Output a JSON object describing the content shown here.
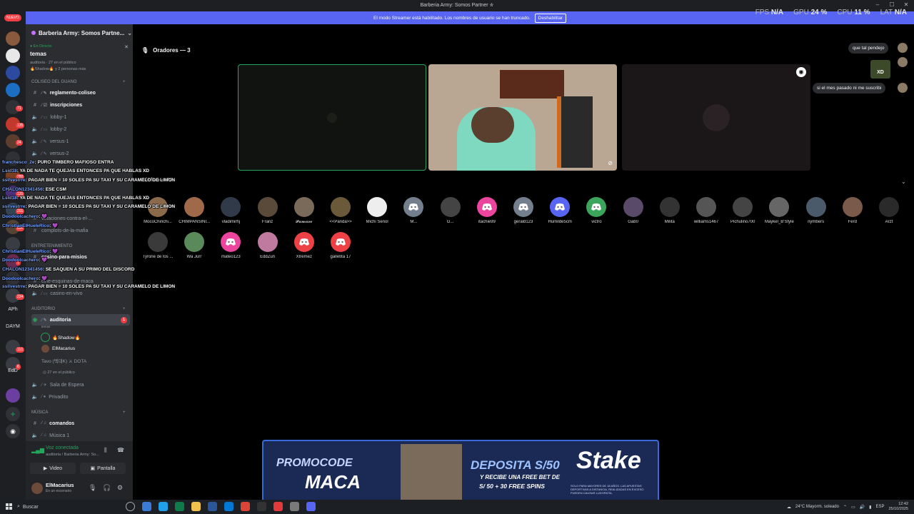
{
  "window": {
    "title": "Barberia Army: Somos Partner ✮"
  },
  "perf": [
    {
      "label": "FPS",
      "value": "N/A"
    },
    {
      "label": "GPU",
      "value": "24 %"
    },
    {
      "label": "CPU",
      "value": "11 %"
    },
    {
      "label": "LAT",
      "value": "N/A"
    }
  ],
  "banner": {
    "text": "El modo Streamer está habilitado. Los nombres de usuario se han truncado.",
    "button": "Deshabilitar"
  },
  "rail": {
    "new_badge": "NUEVO",
    "labels": [
      "APh",
      "DAYM",
      "EdD"
    ],
    "pills": [
      "71",
      "135",
      "24",
      "280",
      "131",
      "201",
      "99+",
      "1",
      "224",
      "110",
      "6"
    ]
  },
  "sidebar": {
    "server_name": "Barberia Army: Somos Partne...",
    "live": {
      "status": "En Directo",
      "name": "temas",
      "meta": "auditoria · 27 en el público",
      "meta2": "🔥Shadow🔥 y 2 personas más"
    },
    "categories": {
      "coliseo": "COLISEO DEL GUANO",
      "entretenimiento": "ENTRETENIMIENTO",
      "auditorio": "AUDITORIO",
      "musica": "MÚSICA"
    },
    "channels": {
      "reglamento": "reglamento-coliseo",
      "inscripciones": "inscripciones",
      "lobby1": "lobby-1",
      "lobby2": "lobby-2",
      "versus1": "versus-1",
      "versus2": "versus-2",
      "votaciones": "votaciones-contra-el-...",
      "complots": "complots-de-la-mafia",
      "casino_misios": "casino-para-misios",
      "cine": "cine-esquinas-de-maca",
      "casino_vivo": "casino-en-vivo",
      "auditoria": "auditoria",
      "auditoria_sub": "temas",
      "sala": "Sala de Espera",
      "privadito": "Privadito",
      "comandos": "comandos",
      "musica1": "Música 1"
    },
    "auditoria_unread": "1",
    "voice_users": [
      "🔥Shadow🔥",
      "ElMacarius",
      "Tavo (텍대K) ⚔ DOTA"
    ],
    "audience": "27 en el público",
    "voice_panel": {
      "state": "Voz conectada",
      "location": "auditoria / Barberia Army: So...",
      "video": "Video",
      "screen": "Pantalla"
    },
    "user": {
      "name": "ElMacarius",
      "status": "En un escenario"
    }
  },
  "chat_overlay": [
    {
      "user": "franchesco_2e",
      "msg": ": PURO TIMBERO MAFIOSO ENTRA"
    },
    {
      "user": "Lsid18",
      "msg": ": YA DE NADA TE QUEJAS ENTONCES PA QUE HABLAS XD"
    },
    {
      "user": "ssilvestrre",
      "msg": ": PAGAR BIEN = 10 SOLES PA SU TAXI Y SU CARAMELO DE LIMON"
    },
    {
      "user": "CHALON12341456",
      "msg": ": ESE CSM"
    },
    {
      "user": "Lsid18",
      "msg": ": YA DE NADA TE QUEJAS ENTONCES PA QUE HABLAS XD"
    },
    {
      "user": "ssilvestrre",
      "msg": ": PAGAR BIEN = 10 SOLES PA SU TAXI Y SU CARAMELO DE LIMON"
    },
    {
      "user": "Doodoolcachero",
      "msg": ": 💜"
    },
    {
      "user": "ChristianElHueleRico",
      "msg": ": 💜"
    },
    {
      "user": "ChristianElHueleRico",
      "msg": ": 💜"
    },
    {
      "user": "Doodoolcachero",
      "msg": ": 💜"
    },
    {
      "user": "CHALON12341456",
      "msg": ": SE SAQUEN A SU PRIMO DEL DISCORD"
    },
    {
      "user": "Doodoolcachero",
      "msg": ": 💜"
    },
    {
      "user": "ssilvestrre",
      "msg": ": PAGAR BIEN = 10 SOLES PA SU TAXI Y SU CARAMELO DE LIMON"
    }
  ],
  "stage": {
    "speakers_label": "Oradores — 3",
    "audience_label": "Público — 27",
    "audience": [
      {
        "name": "MocoChinchi...",
        "kind": "photo"
      },
      {
        "name": "CHIMPANSINI...",
        "kind": "photo"
      },
      {
        "name": "vladimirhj",
        "kind": "photo"
      },
      {
        "name": "Franz",
        "kind": "photo"
      },
      {
        "name": "𝓕𝓪𝓶𝓲𝓬𝓮𝓸",
        "kind": "photo"
      },
      {
        "name": "<<Panda>>",
        "kind": "photo"
      },
      {
        "name": "Michi Señol",
        "kind": "photo"
      },
      {
        "name": "M...",
        "kind": "grey"
      },
      {
        "name": "G...",
        "kind": "photo"
      },
      {
        "name": "itachie99",
        "kind": "pink"
      },
      {
        "name": "gerald123",
        "kind": "grey"
      },
      {
        "name": "Humilde5cm",
        "kind": "dc"
      },
      {
        "name": "victro",
        "kind": "green"
      },
      {
        "name": "Gab0",
        "kind": "photo"
      },
      {
        "name": "Milita",
        "kind": "photo"
      },
      {
        "name": "williams1467",
        "kind": "photo"
      },
      {
        "name": "Pichulino700",
        "kind": "photo"
      },
      {
        "name": "Maykel_B'Style",
        "kind": "photo"
      },
      {
        "name": "nymbers",
        "kind": "photo"
      },
      {
        "name": "Ferd",
        "kind": "photo"
      },
      {
        "name": "Arzt",
        "kind": "photo"
      },
      {
        "name": "Tyrone de los ...",
        "kind": "photo"
      },
      {
        "name": "Wa Jun'",
        "kind": "photo"
      },
      {
        "name": "mateo123",
        "kind": "pink"
      },
      {
        "name": "EddZun",
        "kind": "photo"
      },
      {
        "name": "Xtremez",
        "kind": "red"
      },
      {
        "name": "galletita 17",
        "kind": "red"
      }
    ]
  },
  "bubbles": [
    "que tal pendejo",
    "si el mes pasado ni me suscribi"
  ],
  "xd_badge": "XD",
  "promo": {
    "promocode": "PROMOCODE",
    "code": "MACA",
    "deposit": "DEPOSITA S/50",
    "free": "Y RECIBE UNA FREE BET DE",
    "spins": "S/ 50 + 30 FREE SPINS",
    "brand": "Stake",
    "legal": "SOLO PARA MAYORES DE 18 AÑOS. LAS APUESTAS DEPORTIVAS A DISTANCIA, REALIZADAS EN EXCESO PUEDEN CAUSAR LUDOPATÍA."
  },
  "taskbar": {
    "search": "Buscar",
    "weather": "24°C  Mayorm. soleado",
    "lang": "ESP",
    "time": "12:42",
    "date": "25/10/2025"
  }
}
